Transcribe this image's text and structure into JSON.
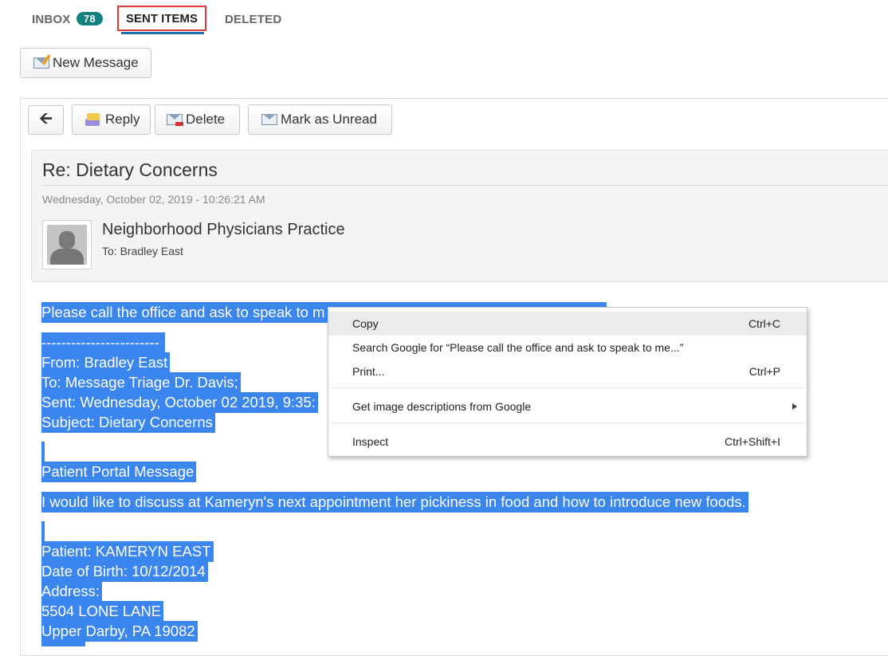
{
  "tabs": {
    "inbox_label": "INBOX",
    "inbox_count": "78",
    "sent_label": "SENT ITEMS",
    "deleted_label": "DELETED"
  },
  "toolbar": {
    "new_message": "New Message",
    "back_icon": "arrow-left-icon",
    "reply": "Reply",
    "delete": "Delete",
    "mark_unread": "Mark as Unread"
  },
  "message": {
    "subject": "Re: Dietary Concerns",
    "date": "Wednesday, October 02, 2019 - 10:26:21 AM",
    "sender": "Neighborhood Physicians Practice",
    "to": "To: Bradley East",
    "body_lines": [
      "Please call the office and ask to speak to m",
      "------------------------",
      "From: Bradley East",
      "To: Message Triage Dr. Davis;",
      "Sent: Wednesday, October 02 2019, 9:35:",
      "Subject: Dietary Concerns",
      "",
      "Patient Portal Message",
      "I would like to discuss at Kameryn's next appointment her pickiness in food and how to introduce new foods.",
      "",
      "Patient: KAMERYN EAST",
      "Date of Birth: 10/12/2014",
      "Address:",
      "5504 LONE LANE",
      "Upper Darby, PA 19082"
    ]
  },
  "context_menu": {
    "items": [
      {
        "label": "Copy",
        "shortcut": "Ctrl+C"
      },
      {
        "label": "Search Google for “Please call the office and ask to speak to me...”",
        "shortcut": ""
      },
      {
        "label": "Print...",
        "shortcut": "Ctrl+P"
      },
      {
        "label": "Get image descriptions from Google",
        "shortcut": ""
      },
      {
        "label": "Inspect",
        "shortcut": "Ctrl+Shift+I"
      }
    ]
  },
  "colors": {
    "selection": "#3a86ee",
    "badge": "#11807f",
    "highlight_border": "#e03a3a"
  }
}
